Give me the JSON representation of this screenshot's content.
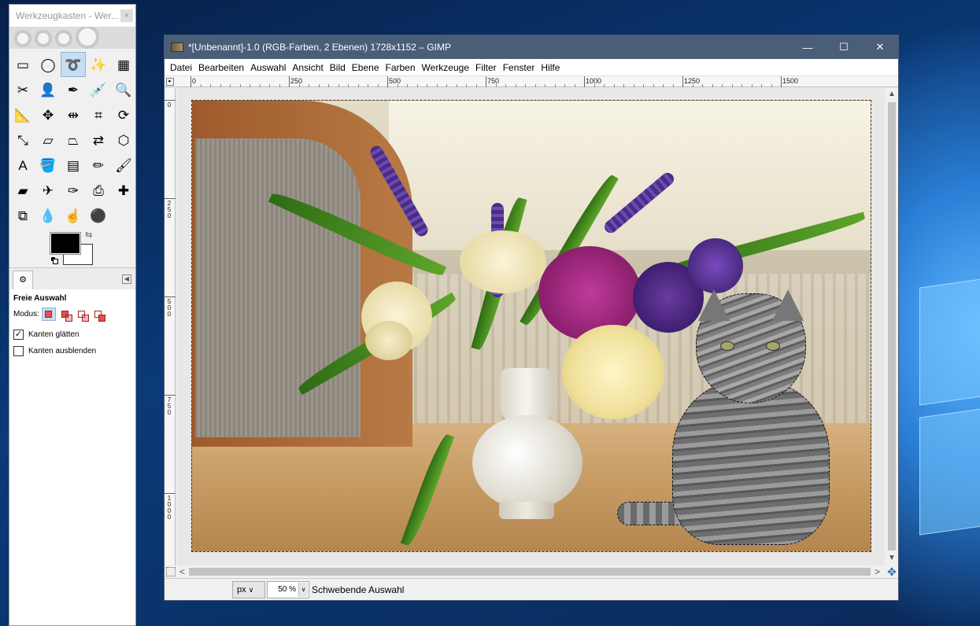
{
  "toolbox": {
    "title": "Werkzeugkasten - Wer...",
    "close": "×",
    "tools": [
      {
        "name": "rect-select-icon",
        "glyph": "▭",
        "active": false
      },
      {
        "name": "ellipse-select-icon",
        "glyph": "◯",
        "active": false
      },
      {
        "name": "free-select-icon",
        "glyph": "➰",
        "active": true
      },
      {
        "name": "fuzzy-select-icon",
        "glyph": "✨",
        "active": false
      },
      {
        "name": "select-by-color-icon",
        "glyph": "▦",
        "active": false
      },
      {
        "name": "scissors-select-icon",
        "glyph": "✂",
        "active": false
      },
      {
        "name": "foreground-select-icon",
        "glyph": "👤",
        "active": false
      },
      {
        "name": "paths-icon",
        "glyph": "✒",
        "active": false
      },
      {
        "name": "color-picker-icon",
        "glyph": "💉",
        "active": false
      },
      {
        "name": "zoom-icon",
        "glyph": "🔍",
        "active": false
      },
      {
        "name": "measure-icon",
        "glyph": "📐",
        "active": false
      },
      {
        "name": "move-icon",
        "glyph": "✥",
        "active": false
      },
      {
        "name": "align-icon",
        "glyph": "⇹",
        "active": false
      },
      {
        "name": "crop-icon",
        "glyph": "⌗",
        "active": false
      },
      {
        "name": "rotate-icon",
        "glyph": "⟳",
        "active": false
      },
      {
        "name": "scale-icon",
        "glyph": "⤡",
        "active": false
      },
      {
        "name": "shear-icon",
        "glyph": "▱",
        "active": false
      },
      {
        "name": "perspective-icon",
        "glyph": "⏢",
        "active": false
      },
      {
        "name": "flip-icon",
        "glyph": "⇄",
        "active": false
      },
      {
        "name": "cage-transform-icon",
        "glyph": "⬡",
        "active": false
      },
      {
        "name": "text-icon",
        "glyph": "A",
        "active": false
      },
      {
        "name": "bucket-fill-icon",
        "glyph": "🪣",
        "active": false
      },
      {
        "name": "blend-icon",
        "glyph": "▤",
        "active": false
      },
      {
        "name": "pencil-icon",
        "glyph": "✏",
        "active": false
      },
      {
        "name": "paintbrush-icon",
        "glyph": "🖌",
        "active": false
      },
      {
        "name": "eraser-icon",
        "glyph": "▰",
        "active": false
      },
      {
        "name": "airbrush-icon",
        "glyph": "✈",
        "active": false
      },
      {
        "name": "ink-icon",
        "glyph": "✑",
        "active": false
      },
      {
        "name": "clone-icon",
        "glyph": "⎙",
        "active": false
      },
      {
        "name": "heal-icon",
        "glyph": "✚",
        "active": false
      },
      {
        "name": "perspective-clone-icon",
        "glyph": "⧉",
        "active": false
      },
      {
        "name": "blur-sharpen-icon",
        "glyph": "💧",
        "active": false
      },
      {
        "name": "smudge-icon",
        "glyph": "☝",
        "active": false
      },
      {
        "name": "dodge-burn-icon",
        "glyph": "⚫",
        "active": false
      }
    ],
    "fg_color": "#000000",
    "bg_color": "#ffffff",
    "swap_glyph": "⇆",
    "options_tab_glyph": "⚙",
    "options_menu_glyph": "◀",
    "options": {
      "title": "Freie Auswahl",
      "modus_label": "Modus:",
      "antialias_label": "Kanten glätten",
      "antialias_checked": "✓",
      "feather_label": "Kanten ausblenden",
      "feather_checked": ""
    }
  },
  "window": {
    "title": "*[Unbenannt]-1.0 (RGB-Farben, 2 Ebenen) 1728x1152 – GIMP",
    "minimize": "—",
    "maximize": "☐",
    "close": "✕",
    "menu": [
      "Datei",
      "Bearbeiten",
      "Auswahl",
      "Ansicht",
      "Bild",
      "Ebene",
      "Farben",
      "Werkzeuge",
      "Filter",
      "Fenster",
      "Hilfe"
    ],
    "ruler_corner": "▸",
    "hruler_labels": [
      "0",
      "250",
      "500",
      "750",
      "1000",
      "1250",
      "1500"
    ],
    "vruler_labels": [
      "0",
      "250",
      "500",
      "750",
      "1000"
    ],
    "scroll_up": "▲",
    "scroll_down": "▼",
    "scroll_left": "<",
    "scroll_right": ">",
    "nav_glyph": "✥"
  },
  "statusbar": {
    "unit": "px",
    "unit_arrow": "∨",
    "zoom": "50 %",
    "zoom_arrow": "∨",
    "message": "Schwebende Auswahl"
  },
  "colors": {
    "title_bar": "#4a5e78",
    "active_tool": "#c7ddf2",
    "desktop": "#0b2d5c"
  }
}
